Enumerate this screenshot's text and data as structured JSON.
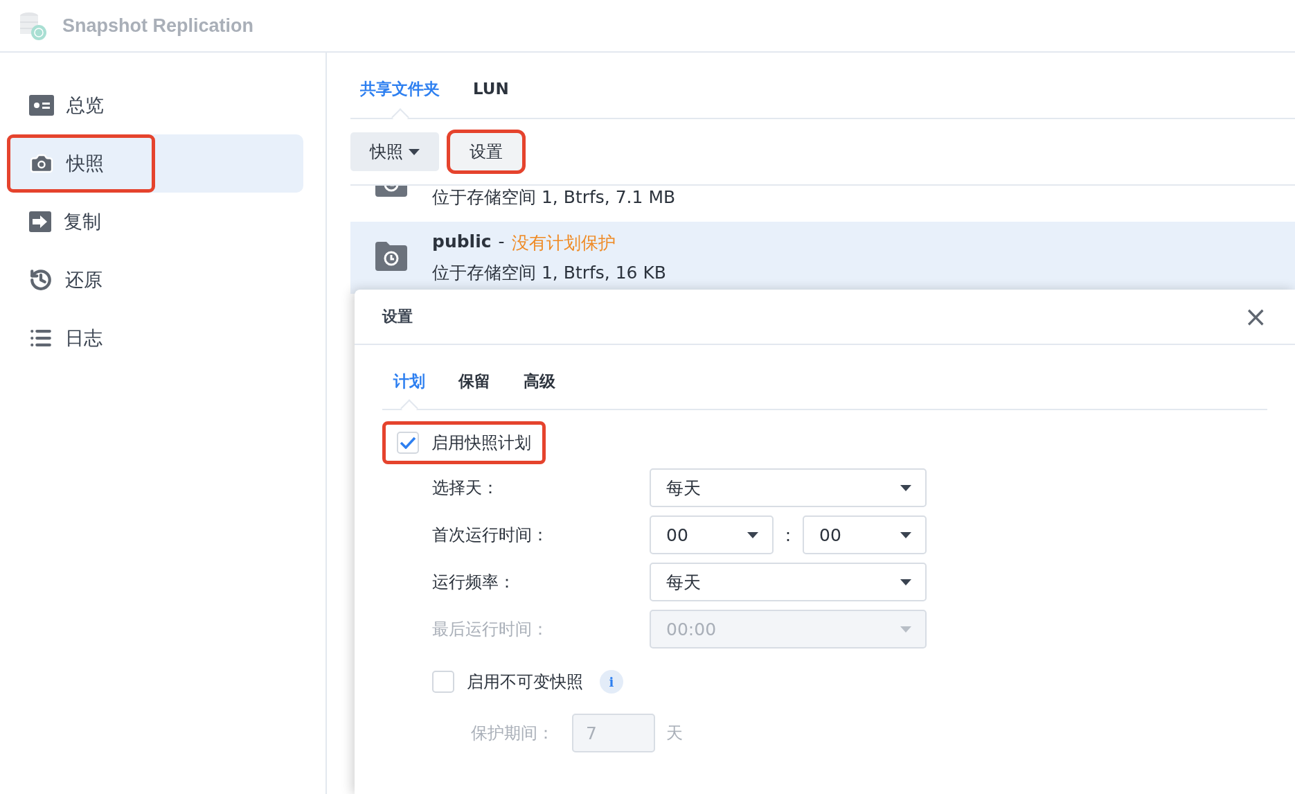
{
  "app": {
    "title": "Snapshot Replication"
  },
  "sidebar": {
    "items": [
      {
        "label": "总览",
        "kind": "overview",
        "selected": false,
        "highlighted": false
      },
      {
        "label": "快照",
        "kind": "camera",
        "selected": true,
        "highlighted": true
      },
      {
        "label": "复制",
        "kind": "replicate",
        "selected": false,
        "highlighted": false
      },
      {
        "label": "还原",
        "kind": "restore",
        "selected": false,
        "highlighted": false
      },
      {
        "label": "日志",
        "kind": "log",
        "selected": false,
        "highlighted": false
      }
    ]
  },
  "tabs": [
    {
      "label": "共享文件夹",
      "selected": true
    },
    {
      "label": "LUN",
      "selected": false
    }
  ],
  "toolbar": {
    "buttons": [
      {
        "label": "快照",
        "kind": "dropdown",
        "highlighted": false
      },
      {
        "label": "设置",
        "kind": "plain",
        "highlighted": true
      }
    ]
  },
  "folders": [
    {
      "detail": "位于存储空间 1, Btrfs, 7.1 MB",
      "selected": false
    },
    {
      "name": "public",
      "separator": "-",
      "status": "没有计划保护",
      "detail": "位于存储空间 1, Btrfs, 16 KB",
      "selected": true
    }
  ],
  "dialog": {
    "title": "设置",
    "close": "×",
    "tabs": [
      {
        "label": "计划",
        "selected": true
      },
      {
        "label": "保留",
        "selected": false
      },
      {
        "label": "高级",
        "selected": false
      }
    ],
    "enable": {
      "label": "启用快照计划",
      "checked": true,
      "highlighted": true
    },
    "fields": [
      {
        "kind": "select",
        "label": "选择天：",
        "value": "每天",
        "disabled": false
      },
      {
        "kind": "time",
        "label": "首次运行时间：",
        "hour": "00",
        "separator": ":",
        "minute": "00",
        "disabled": false
      },
      {
        "kind": "select",
        "label": "运行频率：",
        "value": "每天",
        "disabled": false
      },
      {
        "kind": "select",
        "label": "最后运行时间：",
        "value": "00:00",
        "disabled": true
      }
    ],
    "immutable": {
      "label": "启用不可变快照",
      "checked": false,
      "info": "i"
    },
    "protection": {
      "label": "保护期间：",
      "value": "7",
      "unit": "天",
      "disabled": true
    }
  }
}
